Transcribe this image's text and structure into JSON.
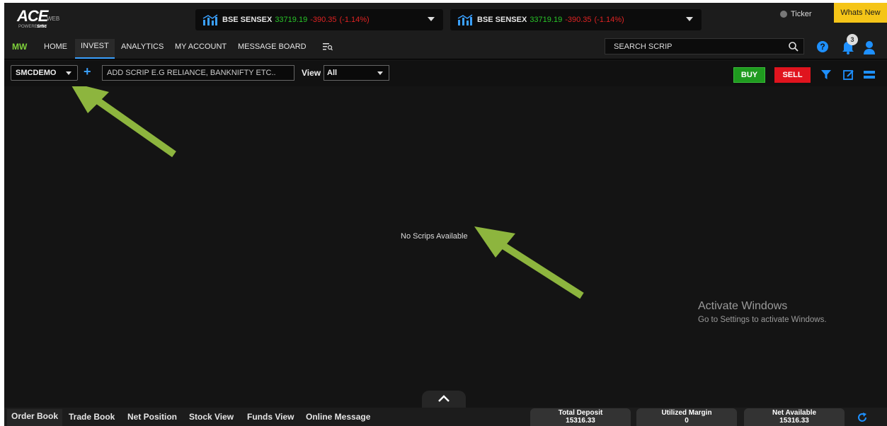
{
  "brand": {
    "logo": "ACE",
    "logo_suffix": "WEB",
    "powered_by": "POWERED BY",
    "company": "smc"
  },
  "tickers": [
    {
      "index": "BSE SENSEX",
      "value": "33719.19",
      "change": "-390.35",
      "percent": "(-1.14%)"
    },
    {
      "index": "BSE SENSEX",
      "value": "33719.19",
      "change": "-390.35",
      "percent": "(-1.14%)"
    }
  ],
  "ticker_toggle": {
    "label": "Ticker"
  },
  "whats_new": "Whats New",
  "nav": {
    "mw": "MW",
    "items": [
      "HOME",
      "INVEST",
      "ANALYTICS",
      "MY ACCOUNT",
      "MESSAGE BOARD"
    ],
    "active": "INVEST",
    "search_placeholder": "SEARCH SCRIP",
    "notification_count": "3"
  },
  "toolbar": {
    "watchlist": "SMCDEMO",
    "add_scrip_placeholder": "ADD SCRIP E.G RELIANCE, BANKNIFTY ETC..",
    "view_label": "View",
    "view_value": "All",
    "buy": "BUY",
    "sell": "SELL"
  },
  "main": {
    "empty_message": "No Scrips Available"
  },
  "activate_windows": {
    "title": "Activate Windows",
    "subtitle": "Go to Settings to activate Windows."
  },
  "bottom_tabs": [
    "Order Book",
    "Trade Book",
    "Net Position",
    "Stock View",
    "Funds View",
    "Online Message"
  ],
  "summary": [
    {
      "label": "Total Deposit",
      "value": "15316.33"
    },
    {
      "label": "Utilized Margin",
      "value": "0"
    },
    {
      "label": "Net Available",
      "value": "15316.33"
    }
  ],
  "colors": {
    "background": "#141414",
    "positive": "#29c529",
    "negative": "#e02323",
    "accent": "#3aa0ff",
    "mw_green": "#7fd13b",
    "whats_new": "#f5c518",
    "annotation_arrow": "#8db53e"
  }
}
